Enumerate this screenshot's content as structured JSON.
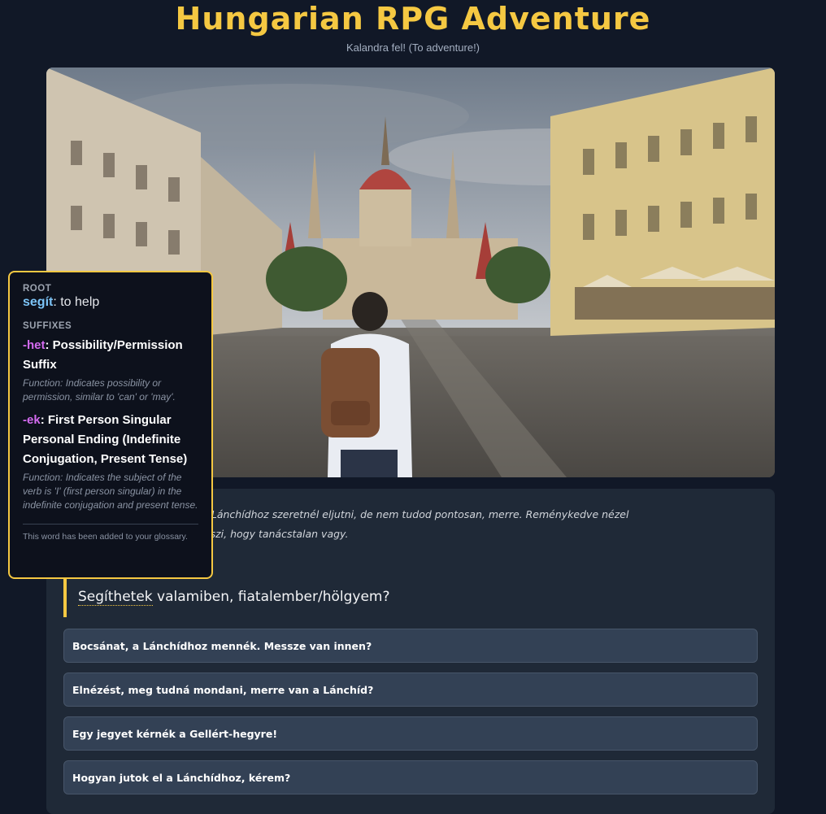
{
  "header": {
    "title": "Hungarian RPG Adventure",
    "subtitle": "Kalandra fel! (To adventure!)"
  },
  "scene": {
    "image_description_icon": "city-square-parliament-image"
  },
  "story": {
    "narration_line1": "gad, egy forgalmas téren. A Lánchídhoz szeretnél eljutni, de nem tudod pontosan, merre. Reménykedve nézel",
    "narration_line2": "étál el melletted, és észreveszi, hogy tanácstalan vagy.",
    "dialogue_word": "Segíthetek",
    "dialogue_rest": " valamiben, fiatalember/hölgyem?"
  },
  "choices": [
    {
      "label": "Bocsánat, a Lánchídhoz mennék. Messze van innen?"
    },
    {
      "label": "Elnézést, meg tudná mondani, merre van a Lánchíd?"
    },
    {
      "label": "Egy jegyet kérnék a Gellért-hegyre!"
    },
    {
      "label": "Hogyan jutok el a Lánchídhoz, kérem?"
    }
  ],
  "tooltip": {
    "root_heading": "ROOT",
    "root_word": "segít",
    "root_meaning": ": to help",
    "suffixes_heading": "SUFFIXES",
    "suffixes": [
      {
        "suffix": "-het",
        "name": ": Possibility/Permission Suffix",
        "function": "Function: Indicates possibility or permission, similar to 'can' or 'may'."
      },
      {
        "suffix": "-ek",
        "name": ": First Person Singular Personal Ending (Indefinite Conjugation, Present Tense)",
        "function": "Function: Indicates the subject of the verb is 'I' (first person singular) in the indefinite conjugation and present tense."
      }
    ],
    "footer": "This word has been added to your glossary."
  },
  "colors": {
    "background": "#111827",
    "accent": "#f5c842",
    "panel": "#1f2937",
    "choice": "#334155",
    "root_word": "#7cc4f7",
    "suffix": "#d46bf0"
  }
}
